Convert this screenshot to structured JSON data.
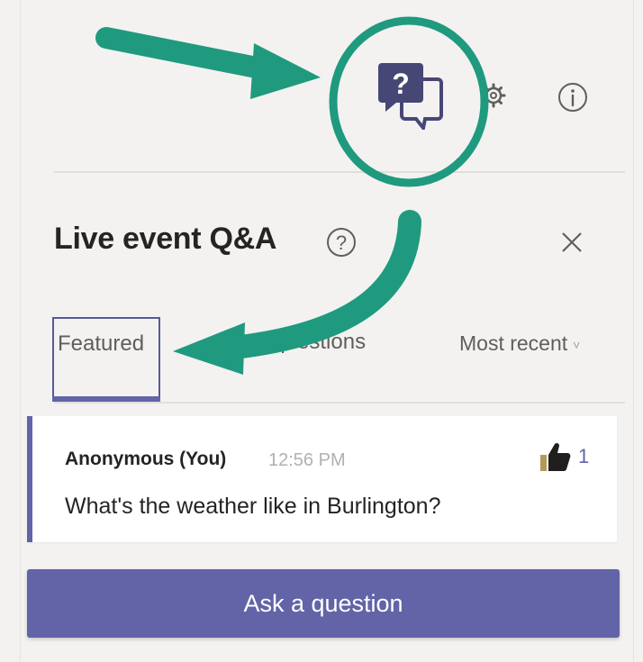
{
  "panel": {
    "title": "Live event Q&A",
    "close_symbol": "×"
  },
  "tabs": [
    {
      "label": "Featured",
      "selected": true
    },
    {
      "label": "All questions",
      "selected": false
    }
  ],
  "sort": {
    "selected": "Most recent",
    "chevron": "˅"
  },
  "question": {
    "author": "Anonymous (You)",
    "time": "12:56 PM",
    "text": "What's the weather like in Burlington?",
    "likes": "1"
  },
  "ask_button": {
    "label": "Ask a question"
  },
  "icons": {
    "toolbar": [
      "qa-icon",
      "gear-icon",
      "info-icon"
    ],
    "header": [
      "help-icon",
      "close-icon"
    ],
    "question": [
      "thumbs-up-icon"
    ]
  },
  "colors": {
    "accent": "#6264a7",
    "qa_icon_dark": "#464775",
    "annotation_teal": "#1f9a7e",
    "background": "#f3f2f1",
    "card": "#ffffff"
  }
}
